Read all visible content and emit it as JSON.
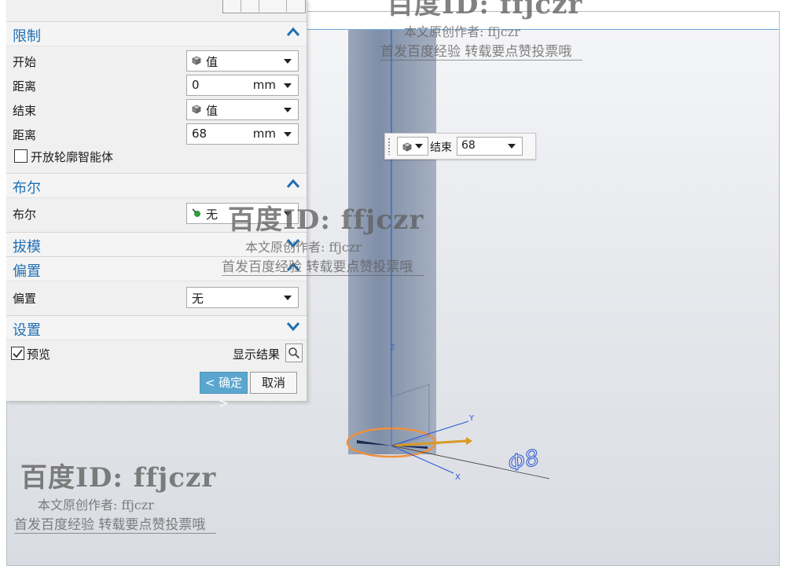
{
  "panel": {
    "limits": {
      "title": "限制",
      "start_label": "开始",
      "start_value": "值",
      "start_distance_label": "距离",
      "start_distance_value": "0",
      "start_unit": "mm",
      "end_label": "结束",
      "end_value": "值",
      "end_distance_label": "距离",
      "end_distance_value": "68",
      "end_unit": "mm",
      "open_profile_label": "开放轮廓智能体",
      "open_profile_checked": false
    },
    "boolean": {
      "title": "布尔",
      "label": "布尔",
      "value": "无"
    },
    "draft": {
      "title": "拔模"
    },
    "offset": {
      "title": "偏置",
      "label": "偏置",
      "value": "无"
    },
    "settings": {
      "title": "设置"
    },
    "preview_label": "预览",
    "preview_checked": true,
    "show_result_label": "显示结果",
    "ok_label": "< 确定 >",
    "cancel_label": "取消"
  },
  "floating_input": {
    "label": "结束",
    "value": "68"
  },
  "viewport": {
    "axis_z": "Z",
    "axis_x": "X",
    "axis_y": "Y",
    "dimension_note": "Φ8"
  },
  "watermark": {
    "id_line": "百度ID: ffjczr",
    "author_line": "本文原创作者: ffjczr",
    "slogan_line": "首发百度经验 转载要点赞投票哦"
  },
  "colors": {
    "accent": "#1f6fb3",
    "ok_button": "#5ba6cf",
    "highlight_orange": "#f0903a",
    "cylinder": "#7f8fa8"
  },
  "icons": {
    "collapse": "chevron-up-icon",
    "expand": "chevron-down-icon",
    "start_type": "cube-icon",
    "boolean_type": "boolean-none-icon",
    "show_result": "magnifier-icon"
  }
}
